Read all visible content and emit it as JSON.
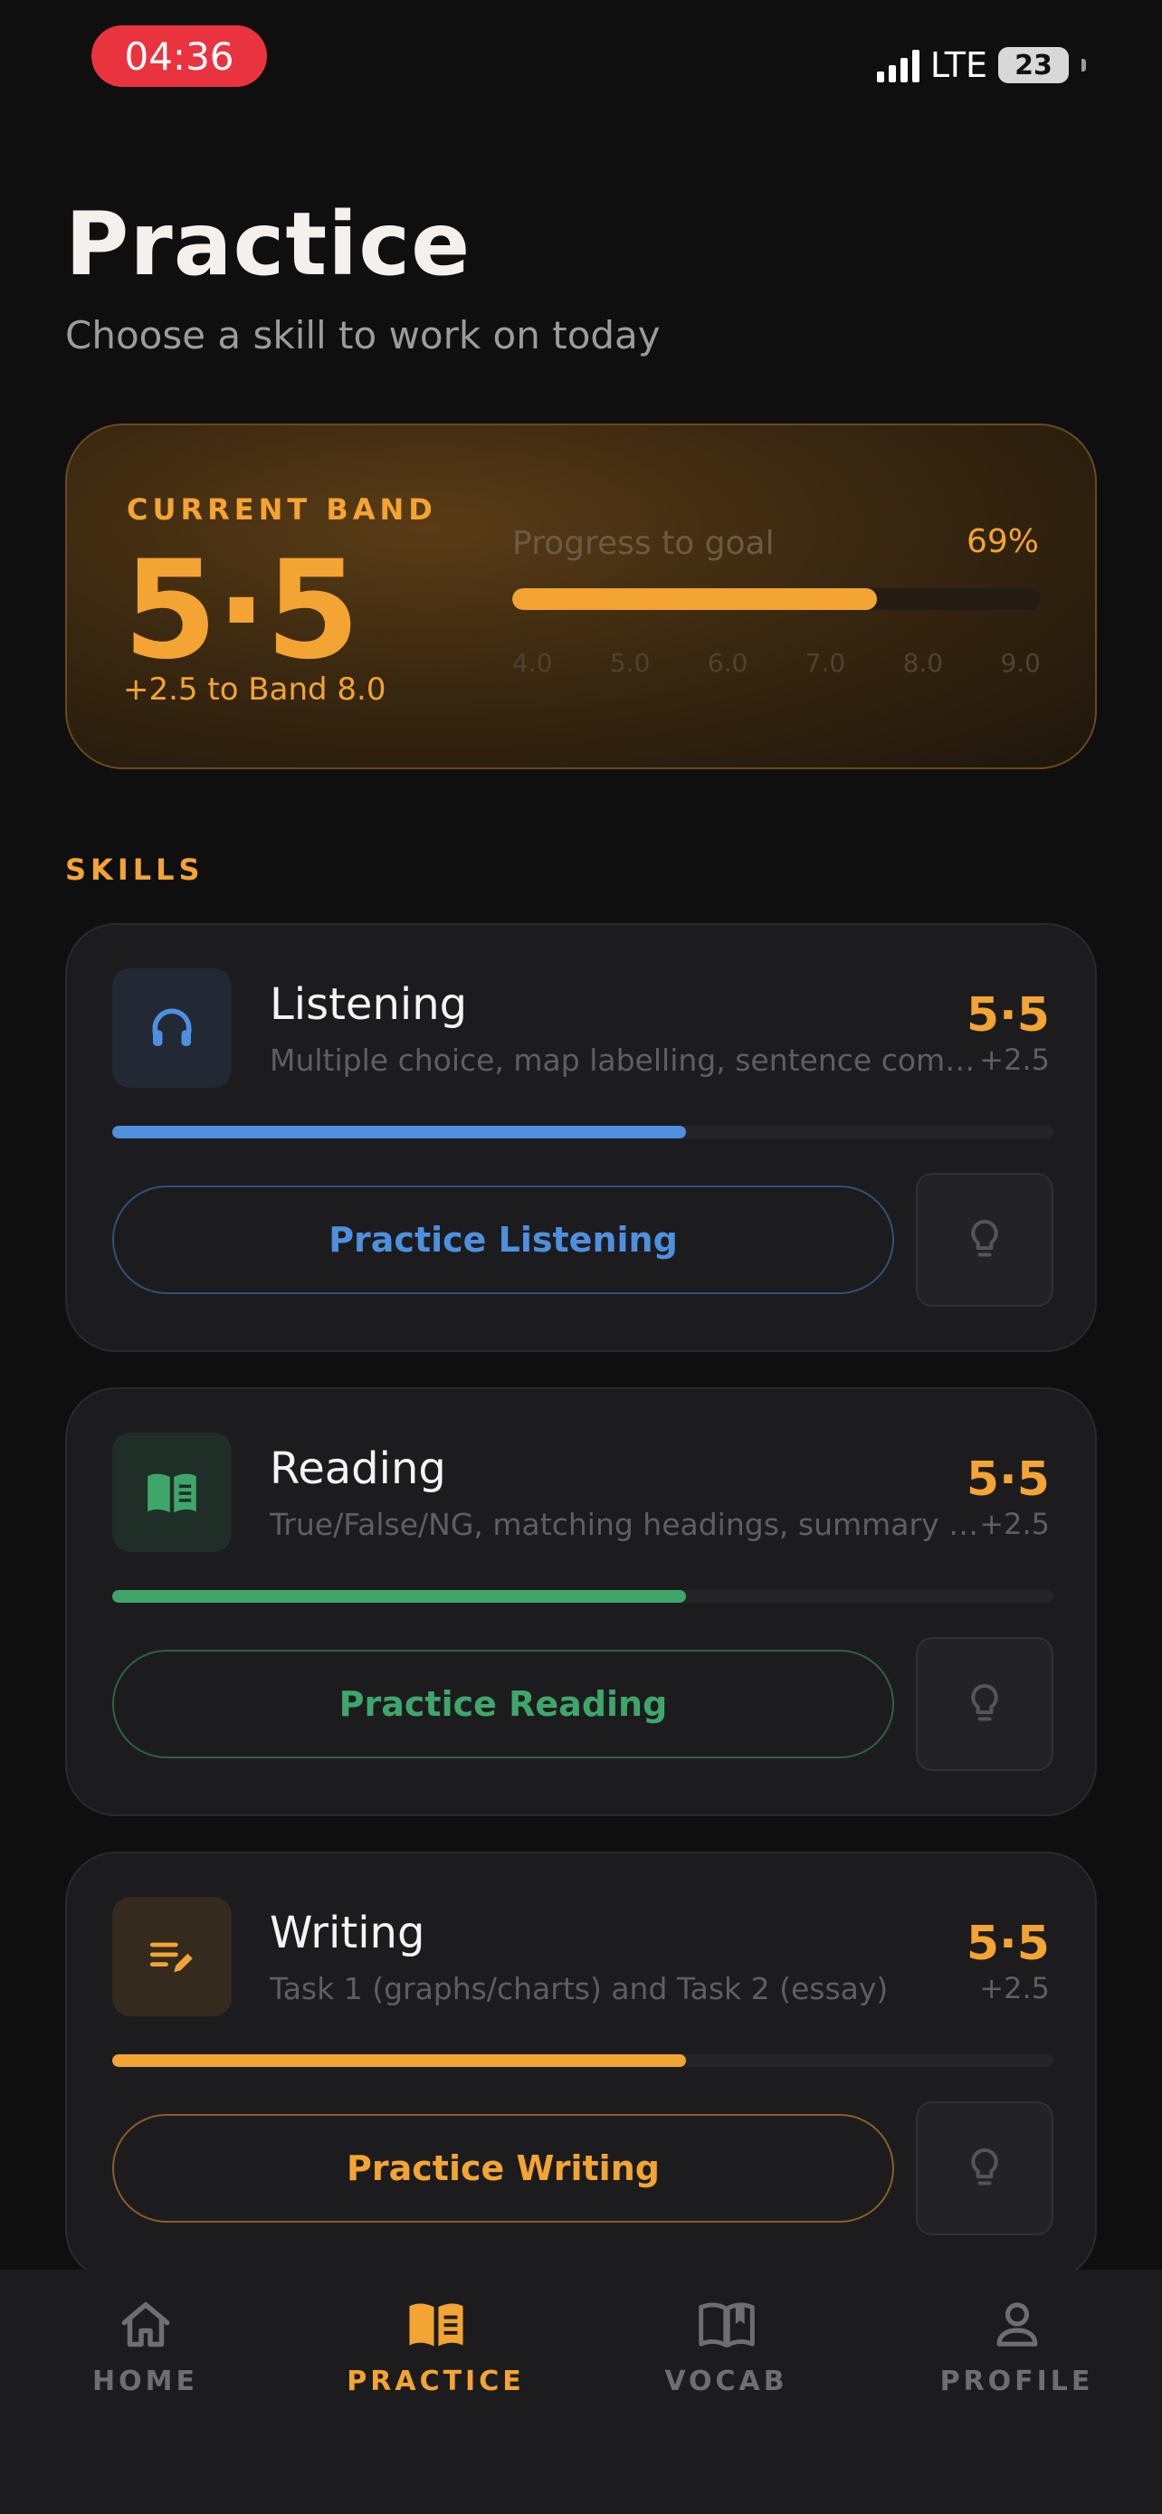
{
  "status_bar": {
    "time": "04:36",
    "network": "LTE",
    "battery": "23"
  },
  "header": {
    "title": "Practice",
    "subtitle": "Choose a skill to work on today"
  },
  "band_card": {
    "label": "CURRENT BAND",
    "value": "5·5",
    "delta_text": "+2.5 to Band 8.0",
    "goal_label": "Progress to goal",
    "goal_percent_text": "69%",
    "goal_progress": 0.69,
    "scale_ticks": [
      "4.0",
      "5.0",
      "6.0",
      "7.0",
      "8.0",
      "9.0"
    ]
  },
  "skills_heading": "SKILLS",
  "skills": [
    {
      "name": "Listening",
      "description": "Multiple choice, map labelling, sentence completion",
      "score": "5·5",
      "delta": "+2.5",
      "progress": 0.61,
      "accent": "#4f8fdf",
      "icon": "headphones-icon",
      "button_label": "Practice Listening"
    },
    {
      "name": "Reading",
      "description": "True/False/NG, matching headings, summary completion",
      "score": "5·5",
      "delta": "+2.5",
      "progress": 0.61,
      "accent": "#3fa66a",
      "icon": "book-icon",
      "button_label": "Practice Reading"
    },
    {
      "name": "Writing",
      "description": "Task 1 (graphs/charts) and Task 2 (essay)",
      "score": "5·5",
      "delta": "+2.5",
      "progress": 0.61,
      "accent": "#f3a432",
      "icon": "edit-notes-icon",
      "button_label": "Practice Writing"
    }
  ],
  "nav": {
    "items": [
      {
        "label": "HOME",
        "icon": "home-icon",
        "active": false
      },
      {
        "label": "PRACTICE",
        "icon": "book-open-icon",
        "active": true
      },
      {
        "label": "VOCAB",
        "icon": "vocab-book-icon",
        "active": false
      },
      {
        "label": "PROFILE",
        "icon": "person-icon",
        "active": false
      }
    ]
  },
  "colors": {
    "accent": "#f3a432",
    "background": "#0f0f10",
    "card": "#1c1c1f"
  }
}
